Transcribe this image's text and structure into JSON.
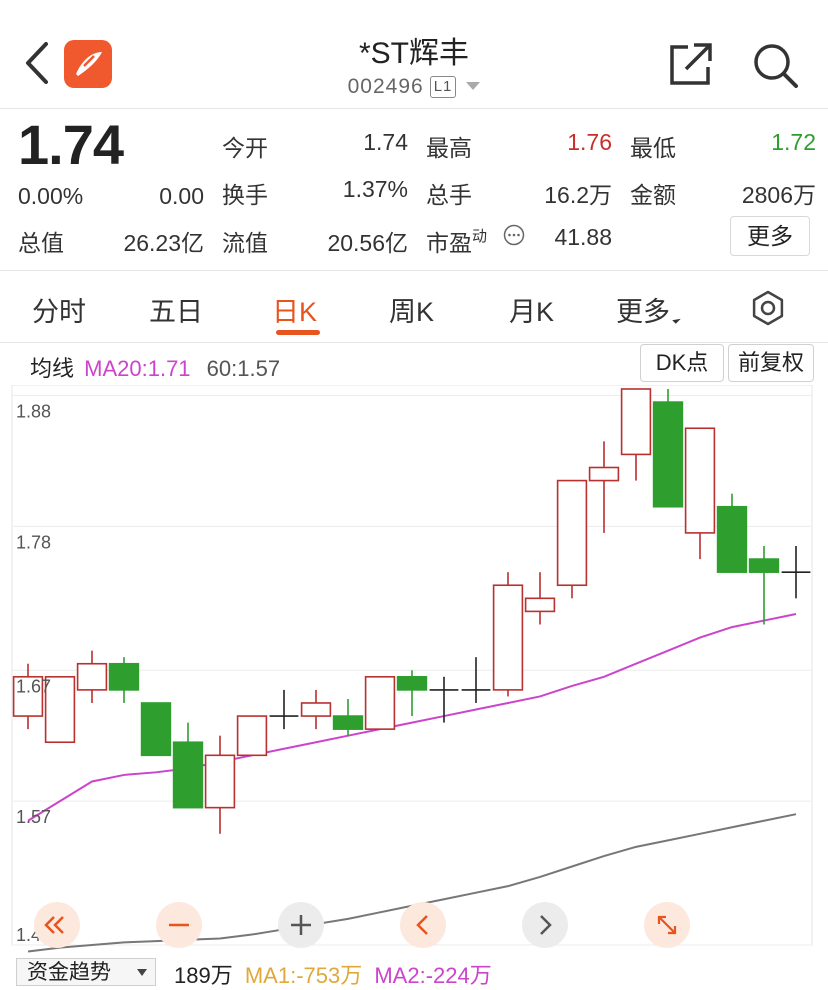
{
  "header": {
    "title": "*ST辉丰",
    "code": "002496",
    "level": "L1"
  },
  "quote": {
    "price": "1.74",
    "change_pct": "0.00%",
    "change_amt": "0.00",
    "fields": {
      "open_label": "今开",
      "open": "1.74",
      "high_label": "最高",
      "high": "1.76",
      "low_label": "最低",
      "low": "1.72",
      "turnover_label": "换手",
      "turnover": "1.37%",
      "volume_label": "总手",
      "volume": "16.2万",
      "amount_label": "金额",
      "amount": "2806万",
      "mktcap_label": "总值",
      "mktcap": "26.23亿",
      "float_label": "流值",
      "float": "20.56亿",
      "pe_label": "市盈",
      "pe_sup": "动",
      "pe": "41.88"
    },
    "more_label": "更多"
  },
  "colors": {
    "up": "#b8312f",
    "down": "#2e9e2e",
    "accent": "#e8541e",
    "ma20": "#cc44cc",
    "ma60": "#777777"
  },
  "tabs": [
    {
      "label": "分时"
    },
    {
      "label": "五日"
    },
    {
      "label": "日K"
    },
    {
      "label": "周K"
    },
    {
      "label": "月K"
    },
    {
      "label": "更多"
    }
  ],
  "ma": {
    "label": "均线",
    "ma20": "MA20:1.71",
    "ma60": "60:1.57",
    "dk_label": "DK点",
    "adjust_label": "前复权"
  },
  "chart_data": {
    "type": "candlestick",
    "y_ticks": [
      "1.88",
      "1.78",
      "1.67",
      "1.57",
      "1.46"
    ],
    "ylim": [
      1.46,
      1.885
    ],
    "candles": [
      {
        "o": 1.635,
        "h": 1.675,
        "l": 1.625,
        "c": 1.665
      },
      {
        "o": 1.615,
        "h": 1.665,
        "l": 1.615,
        "c": 1.665
      },
      {
        "o": 1.655,
        "h": 1.685,
        "l": 1.645,
        "c": 1.675
      },
      {
        "o": 1.675,
        "h": 1.68,
        "l": 1.645,
        "c": 1.655
      },
      {
        "o": 1.645,
        "h": 1.645,
        "l": 1.605,
        "c": 1.605
      },
      {
        "o": 1.615,
        "h": 1.63,
        "l": 1.565,
        "c": 1.565
      },
      {
        "o": 1.565,
        "h": 1.62,
        "l": 1.545,
        "c": 1.605
      },
      {
        "o": 1.605,
        "h": 1.635,
        "l": 1.605,
        "c": 1.635
      },
      {
        "o": 1.635,
        "h": 1.655,
        "l": 1.625,
        "c": 1.635
      },
      {
        "o": 1.635,
        "h": 1.655,
        "l": 1.625,
        "c": 1.645
      },
      {
        "o": 1.635,
        "h": 1.648,
        "l": 1.62,
        "c": 1.625
      },
      {
        "o": 1.625,
        "h": 1.665,
        "l": 1.625,
        "c": 1.665
      },
      {
        "o": 1.665,
        "h": 1.67,
        "l": 1.635,
        "c": 1.655
      },
      {
        "o": 1.655,
        "h": 1.665,
        "l": 1.63,
        "c": 1.655
      },
      {
        "o": 1.655,
        "h": 1.68,
        "l": 1.645,
        "c": 1.655
      },
      {
        "o": 1.655,
        "h": 1.745,
        "l": 1.65,
        "c": 1.735
      },
      {
        "o": 1.715,
        "h": 1.745,
        "l": 1.705,
        "c": 1.725
      },
      {
        "o": 1.735,
        "h": 1.815,
        "l": 1.725,
        "c": 1.815
      },
      {
        "o": 1.815,
        "h": 1.845,
        "l": 1.775,
        "c": 1.825
      },
      {
        "o": 1.835,
        "h": 1.885,
        "l": 1.815,
        "c": 1.885
      },
      {
        "o": 1.875,
        "h": 1.885,
        "l": 1.795,
        "c": 1.795
      },
      {
        "o": 1.775,
        "h": 1.855,
        "l": 1.755,
        "c": 1.855
      },
      {
        "o": 1.795,
        "h": 1.805,
        "l": 1.745,
        "c": 1.745
      },
      {
        "o": 1.755,
        "h": 1.765,
        "l": 1.705,
        "c": 1.745
      },
      {
        "o": 1.745,
        "h": 1.765,
        "l": 1.725,
        "c": 1.745
      }
    ],
    "ma20": [
      1.555,
      1.57,
      1.585,
      1.59,
      1.592,
      1.595,
      1.6,
      1.605,
      1.61,
      1.615,
      1.62,
      1.625,
      1.63,
      1.635,
      1.64,
      1.645,
      1.65,
      1.658,
      1.665,
      1.675,
      1.685,
      1.695,
      1.703,
      1.708,
      1.713
    ],
    "ma60": [
      1.455,
      1.458,
      1.46,
      1.462,
      1.463,
      1.464,
      1.465,
      1.468,
      1.472,
      1.476,
      1.48,
      1.485,
      1.49,
      1.495,
      1.5,
      1.505,
      1.512,
      1.52,
      1.528,
      1.535,
      1.54,
      1.545,
      1.55,
      1.555,
      1.56
    ]
  },
  "bottom": {
    "fund_label": "资金趋势",
    "volume": "189万",
    "ma1": "MA1:-753万",
    "ma2": "MA2:-224万"
  }
}
